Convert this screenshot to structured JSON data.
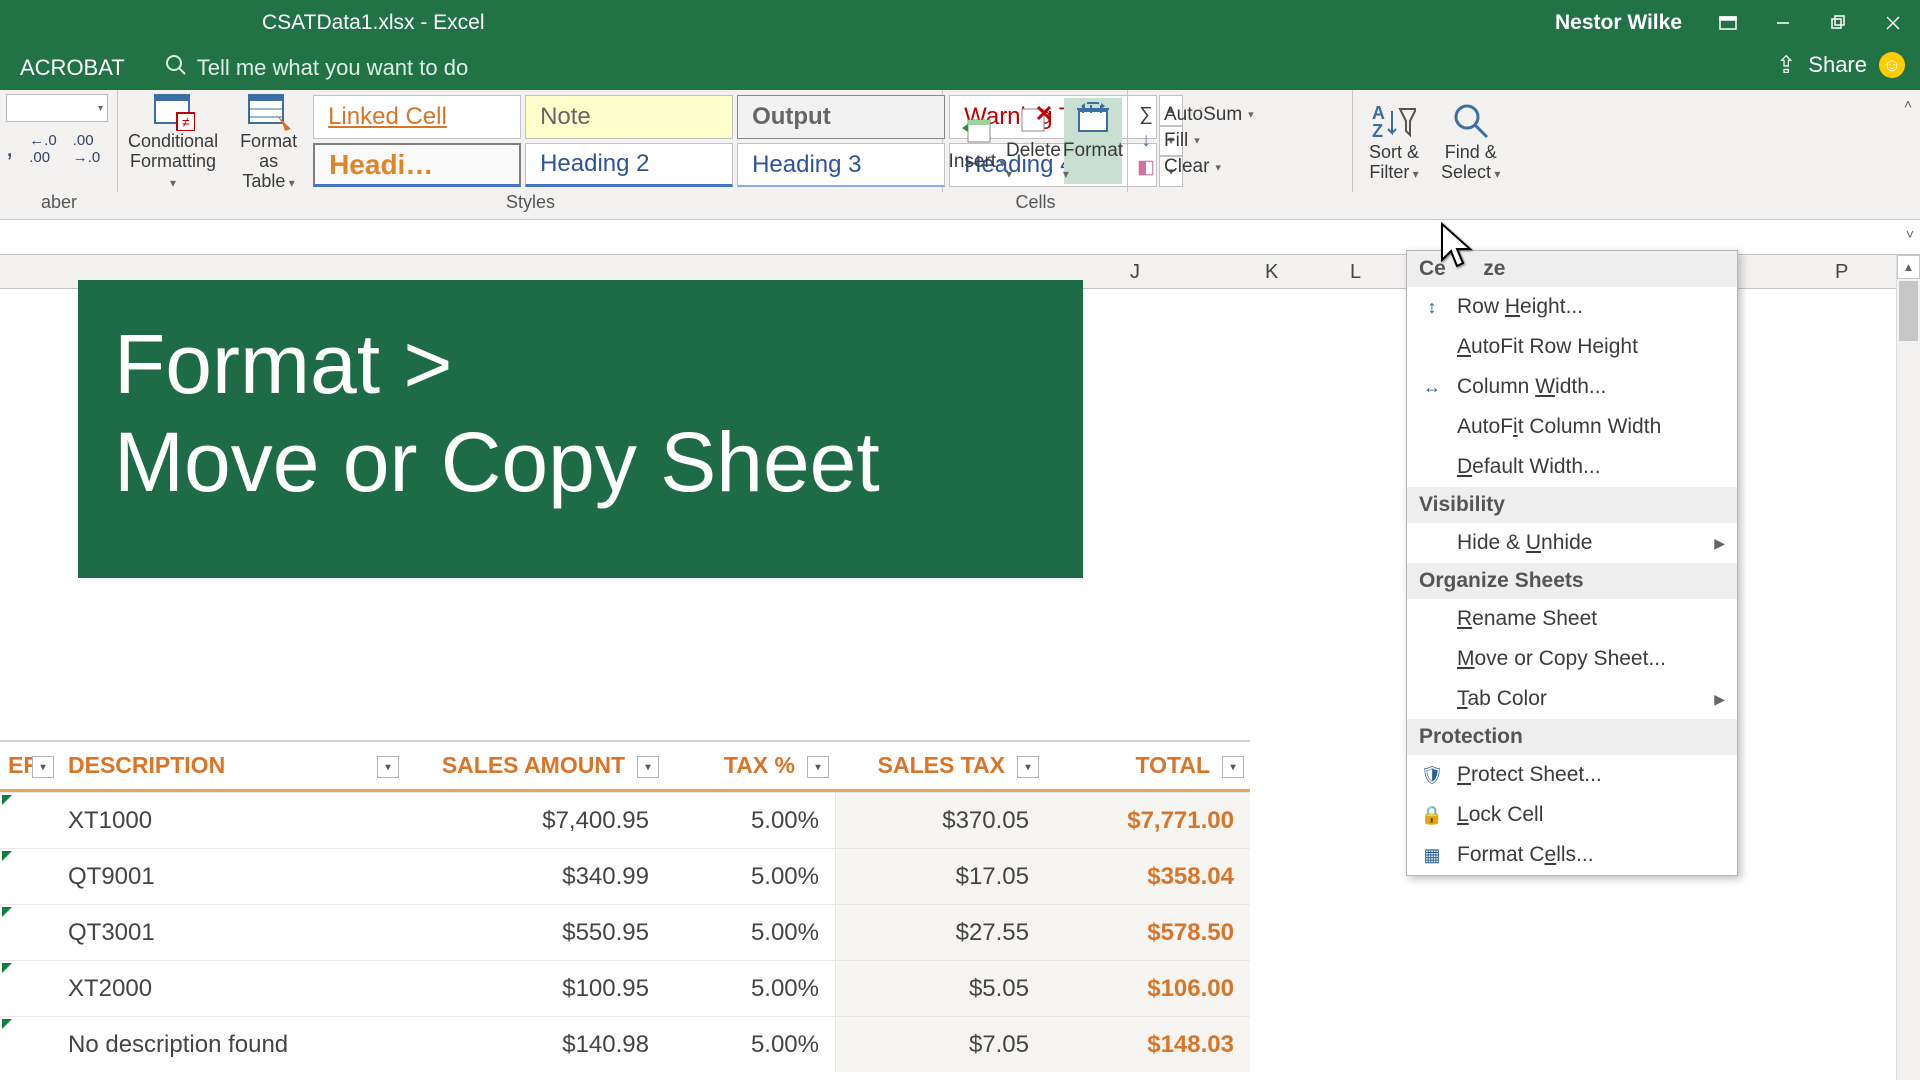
{
  "title_bar": {
    "filename": "CSATData1.xlsx  -  Excel",
    "user": "Nestor Wilke"
  },
  "tabs": {
    "acrobat": "ACROBAT",
    "tellme_placeholder": "Tell me what you want to do",
    "share": "Share"
  },
  "ribbon": {
    "number_group": {
      "label": "aber",
      "comma": ",",
      "inc": ".0\n.00",
      "dec": ".00\n→.0"
    },
    "styles": {
      "label": "Styles",
      "cond_fmt": "Conditional\nFormatting",
      "fmt_table": "Format as\nTable",
      "cells": {
        "linked": "Linked Cell",
        "note": "Note",
        "output": "Output",
        "warning": "Warning Text",
        "h1": "Headi…",
        "h2": "Heading 2",
        "h3": "Heading 3",
        "h4": "Heading 4"
      }
    },
    "cells_group": {
      "label": "Cells",
      "insert": "Insert",
      "delete": "Delete",
      "format": "Format"
    },
    "editing": {
      "autosum": "AutoSum",
      "fill": "Fill",
      "clear": "Clear",
      "sort": "Sort &\nFilter",
      "find": "Find &\nSelect"
    }
  },
  "annotation": {
    "line1": "Format  >",
    "line2": "Move or Copy Sheet"
  },
  "columns": {
    "j": "J",
    "k": "K",
    "l": "L",
    "p": "P"
  },
  "table": {
    "headers": {
      "er": "ER",
      "description": "DESCRIPTION",
      "sales_amount": "SALES AMOUNT",
      "tax_pct": "TAX %",
      "sales_tax": "SALES TAX",
      "total": "TOTAL"
    },
    "rows": [
      {
        "desc": "XT1000",
        "amt": "$7,400.95",
        "tax": "5.00%",
        "stax": "$370.05",
        "total": "$7,771.00"
      },
      {
        "desc": "QT9001",
        "amt": "$340.99",
        "tax": "5.00%",
        "stax": "$17.05",
        "total": "$358.04"
      },
      {
        "desc": "QT3001",
        "amt": "$550.95",
        "tax": "5.00%",
        "stax": "$27.55",
        "total": "$578.50"
      },
      {
        "desc": "XT2000",
        "amt": "$100.95",
        "tax": "5.00%",
        "stax": "$5.05",
        "total": "$106.00"
      },
      {
        "desc": "No description found",
        "amt": "$140.98",
        "tax": "5.00%",
        "stax": "$7.05",
        "total": "$148.03"
      }
    ]
  },
  "format_menu": {
    "sections": {
      "cellsize": "Cell Size",
      "visibility": "Visibility",
      "organize": "Organize Sheets",
      "protection": "Protection"
    },
    "items": {
      "row_height": "Row Height...",
      "autofit_row": "AutoFit Row Height",
      "col_width": "Column Width...",
      "autofit_col": "AutoFit Column Width",
      "default_width": "Default Width...",
      "hide_unhide": "Hide & Unhide",
      "rename": "Rename Sheet",
      "move_copy": "Move or Copy Sheet...",
      "tab_color": "Tab Color",
      "protect": "Protect Sheet...",
      "lock": "Lock Cell",
      "format_cells": "Format Cells..."
    }
  }
}
